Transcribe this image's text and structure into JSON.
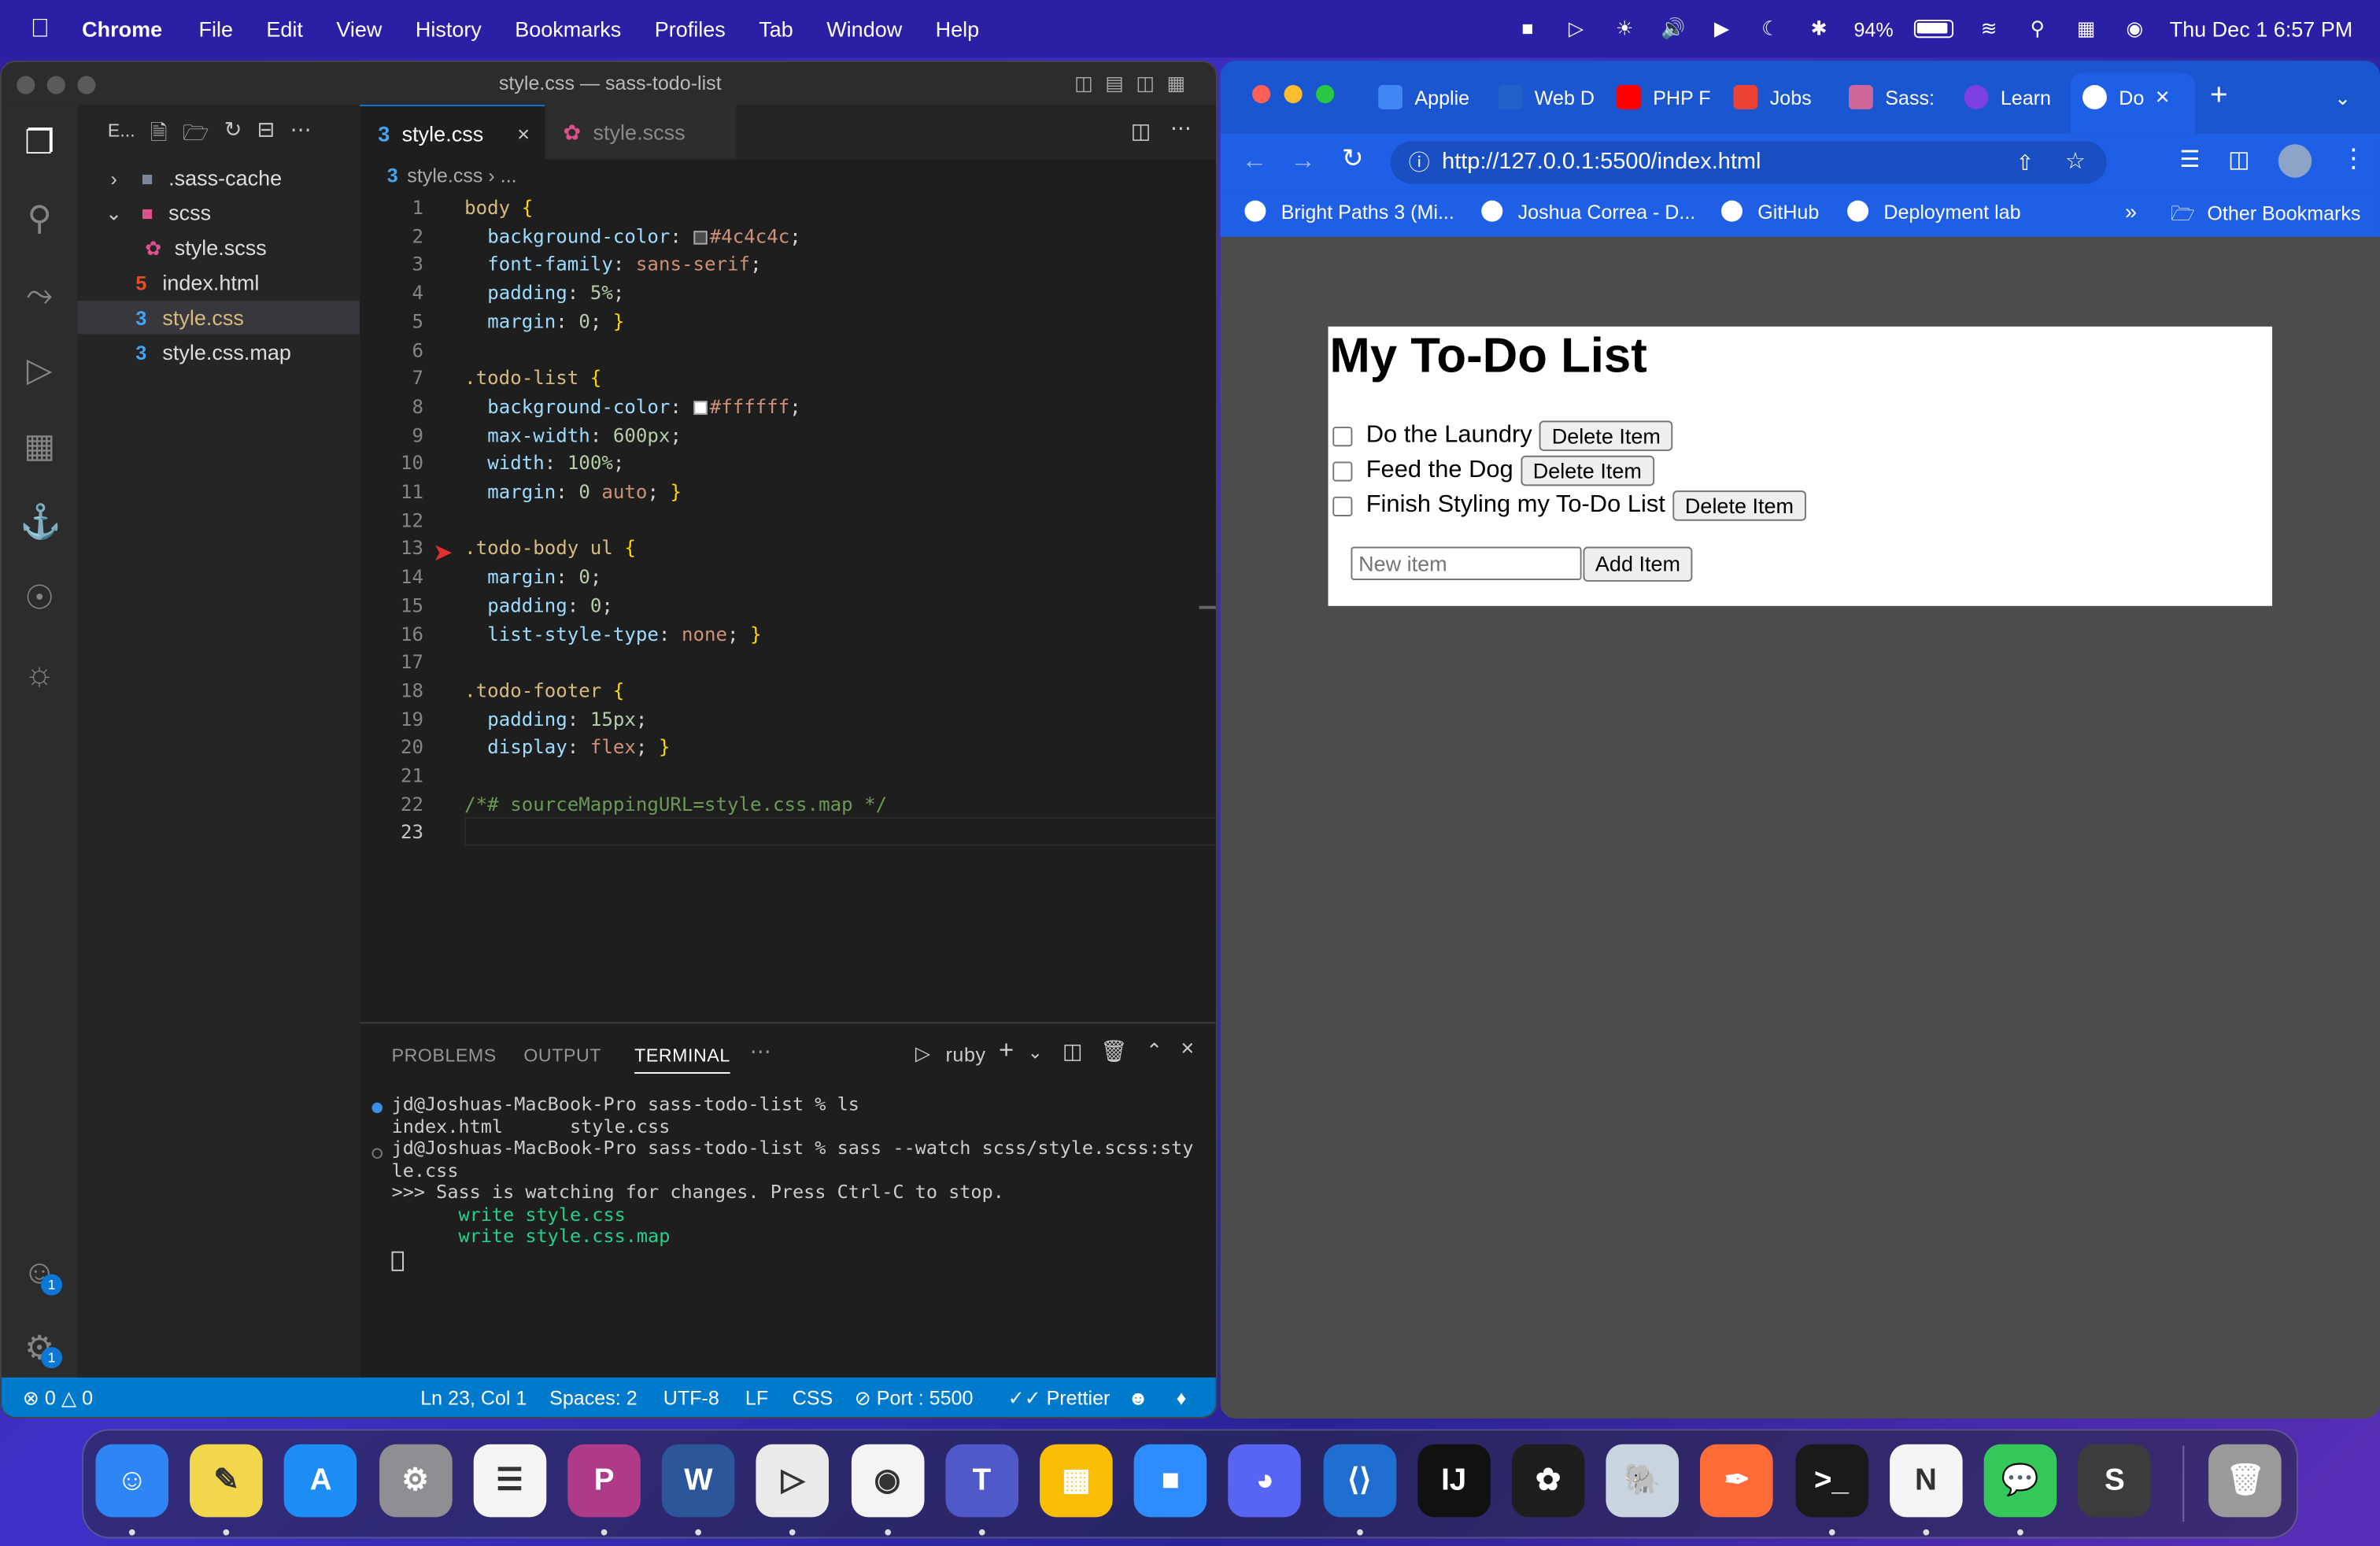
{
  "menubar": {
    "app": "Chrome",
    "items": [
      "File",
      "Edit",
      "View",
      "History",
      "Bookmarks",
      "Profiles",
      "Tab",
      "Window",
      "Help"
    ],
    "battery": "94%",
    "datetime": "Thu Dec 1  6:57 PM"
  },
  "vscode": {
    "window_title": "style.css — sass-todo-list",
    "explorer_label": "E...",
    "tree": [
      {
        "label": ".sass-cache",
        "type": "folder-closed"
      },
      {
        "label": "scss",
        "type": "folder-open"
      },
      {
        "label": "style.scss",
        "type": "scss"
      },
      {
        "label": "index.html",
        "type": "html"
      },
      {
        "label": "style.css",
        "type": "css"
      },
      {
        "label": "style.css.map",
        "type": "map"
      }
    ],
    "tabs": [
      {
        "label": "style.css",
        "active": true
      },
      {
        "label": "style.scss",
        "active": false
      }
    ],
    "breadcrumb": "style.css",
    "breadcrumb_more": "...",
    "code": [
      {
        "n": "1",
        "text": "body {"
      },
      {
        "n": "2",
        "text": "  background-color: #4c4c4c;"
      },
      {
        "n": "3",
        "text": "  font-family: sans-serif;"
      },
      {
        "n": "4",
        "text": "  padding: 5%;"
      },
      {
        "n": "5",
        "text": "  margin: 0; }"
      },
      {
        "n": "6",
        "text": ""
      },
      {
        "n": "7",
        "text": ".todo-list {"
      },
      {
        "n": "8",
        "text": "  background-color: #ffffff;"
      },
      {
        "n": "9",
        "text": "  max-width: 600px;"
      },
      {
        "n": "10",
        "text": "  width: 100%;"
      },
      {
        "n": "11",
        "text": "  margin: 0 auto; }"
      },
      {
        "n": "12",
        "text": ""
      },
      {
        "n": "13",
        "text": ".todo-body ul {"
      },
      {
        "n": "14",
        "text": "  margin: 0;"
      },
      {
        "n": "15",
        "text": "  padding: 0;"
      },
      {
        "n": "16",
        "text": "  list-style-type: none; }"
      },
      {
        "n": "17",
        "text": ""
      },
      {
        "n": "18",
        "text": ".todo-footer {"
      },
      {
        "n": "19",
        "text": "  padding: 15px;"
      },
      {
        "n": "20",
        "text": "  display: flex; }"
      },
      {
        "n": "21",
        "text": ""
      },
      {
        "n": "22",
        "text": "/*# sourceMappingURL=style.css.map */"
      },
      {
        "n": "23",
        "text": ""
      }
    ],
    "panel_tabs": [
      "PROBLEMS",
      "OUTPUT",
      "TERMINAL"
    ],
    "terminal_shell": "ruby",
    "terminal": [
      "jd@Joshuas-MacBook-Pro sass-todo-list % ls",
      "index.html      style.css",
      "jd@Joshuas-MacBook-Pro sass-todo-list % sass --watch scss/style.scss:sty",
      "le.css",
      ">>> Sass is watching for changes. Press Ctrl-C to stop.",
      "      write style.css",
      "      write style.css.map"
    ],
    "status": {
      "errors": "0",
      "warnings": "0",
      "position": "Ln 23, Col 1",
      "spaces": "Spaces: 2",
      "encoding": "UTF-8",
      "eol": "LF",
      "language": "CSS",
      "port": "Port : 5500",
      "prettier": "Prettier"
    },
    "badge_count": "1"
  },
  "chrome": {
    "tabs": [
      "Applie",
      "Web D",
      "PHP F",
      "Jobs",
      "Sass:",
      "Learn",
      "Do"
    ],
    "url": "http://127.0.0.1:5500/index.html",
    "bookmarks": [
      "Bright Paths 3 (Mi...",
      "Joshua Correa - D...",
      "GitHub",
      "Deployment lab"
    ],
    "bookmarks_more": "»",
    "other_bookmarks": "Other Bookmarks"
  },
  "todo": {
    "title": "My To-Do List",
    "items": [
      "Do the Laundry",
      "Feed the Dog",
      "Finish Styling my To-Do List"
    ],
    "delete_label": "Delete Item",
    "input_placeholder": "New item",
    "add_label": "Add Item"
  },
  "dock": [
    "Finder",
    "Notes",
    "App Store",
    "System Settings",
    "Reminders",
    "Pockity",
    "Word",
    "Play",
    "Chrome",
    "Teams",
    "Keynote",
    "Zoom",
    "Discord",
    "VS Code",
    "IntelliJ",
    "Figma",
    "pgAdmin",
    "Postman",
    "Terminal",
    "Notion",
    "Messages",
    "Sublime",
    "Trash"
  ],
  "colors": {
    "menubar": "#2b1fa6",
    "chrome_accent": "#1f5fe6",
    "vscode_status": "#007acc"
  }
}
